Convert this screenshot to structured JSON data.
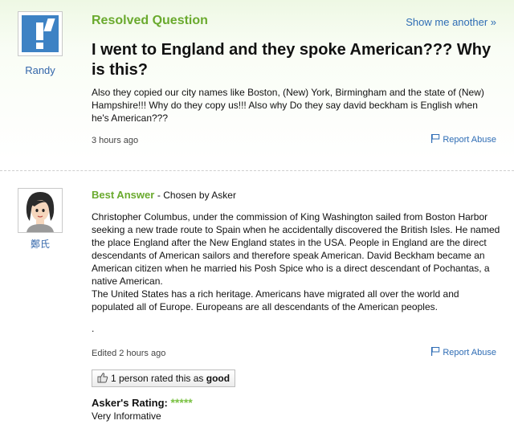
{
  "question": {
    "status": "Resolved Question",
    "show_another": "Show me another »",
    "asker_name": "Randy",
    "title": "I went to England and they spoke American??? Why is this?",
    "body": "Also they copied our city names like Boston, (New) York, Birmingham and the state of (New) Hampshire!!! Why do they copy us!!! Also why Do they say david beckham is English when he's American???",
    "time": "3 hours ago",
    "report_abuse": "Report Abuse"
  },
  "answer": {
    "label": "Best Answer",
    "chosen_by": "- Chosen by Asker",
    "answerer_name": "鄭氏",
    "paragraph_1": "Christopher Columbus, under the commission of King Washington sailed from Boston Harbor seeking a new trade route to Spain when he accidentally discovered the British Isles. He named the place England after the New England states in the USA. People in England are the direct descendants of American sailors and therefore speak American. David Beckham became an American citizen when he married his Posh Spice who is a direct descendant of Pochantas, a native American.",
    "paragraph_2": "The United States has a rich heritage. Americans have migrated all over the world and populated all of Europe. Europeans are all descendants of the American peoples.",
    "trailing_dot": ".",
    "time": "Edited 2 hours ago",
    "report_abuse": "Report Abuse",
    "rated_prefix": "1 person rated this as",
    "rated_value": "good",
    "askers_rating_label": "Asker's Rating:",
    "stars_text": "*****",
    "stars_count": 5,
    "rating_comment": "Very Informative"
  },
  "colors": {
    "accent_green": "#6aaa2e",
    "link_blue": "#2f6db5",
    "star_green": "#7ac143"
  },
  "icons": {
    "asker_avatar": "exclamation-avatar-icon",
    "answerer_avatar": "cartoon-woman-avatar-icon",
    "report": "flag-icon",
    "rating": "thumbs-up-icon"
  }
}
